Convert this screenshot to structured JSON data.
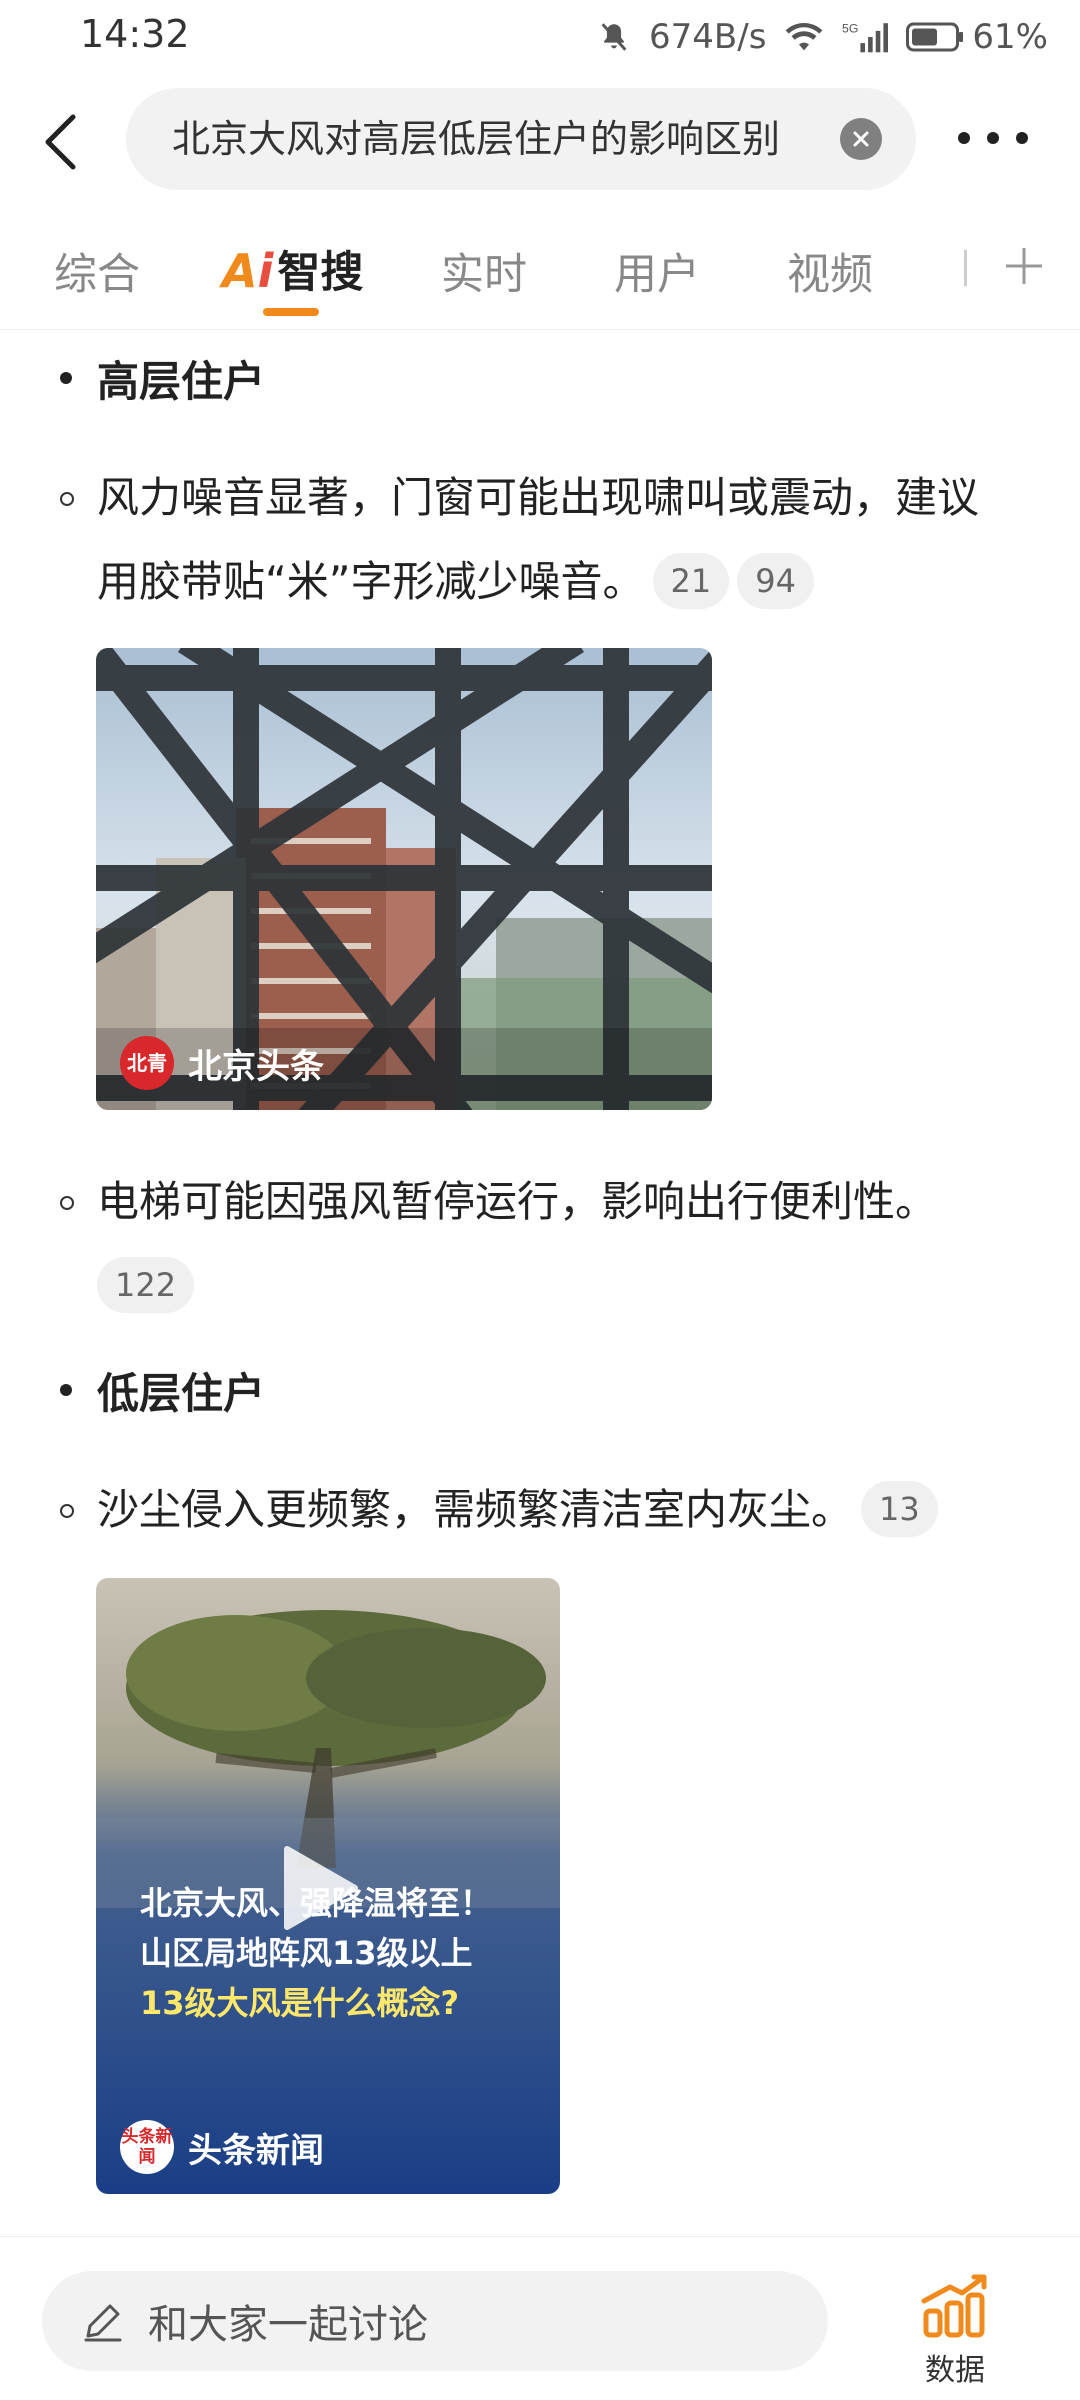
{
  "status_bar": {
    "time": "14:32",
    "network_speed": "674B/s",
    "signal_type": "5G",
    "battery_percent": "61%",
    "battery_level": 0.61
  },
  "header": {
    "search_query": "北京大风对高层低层住户的影响区别",
    "icons": [
      "back-arrow-icon",
      "clear-icon",
      "more-icon"
    ]
  },
  "tabs": {
    "items": [
      "综合",
      "智搜",
      "实时",
      "用户",
      "视频"
    ],
    "ai_prefix": "Ai",
    "active": "智搜"
  },
  "content": {
    "section1": {
      "heading": "高层住户",
      "item1": {
        "text": "风力噪音显著，门窗可能出现啸叫或震动，建议用胶带贴“米”字形减少噪音。",
        "cites": [
          "21",
          "94"
        ]
      },
      "image1": {
        "source": "北京头条",
        "logo_text": "北青"
      },
      "item2": {
        "text": "电梯可能因强风暂停运行，影响出行便利性。",
        "cites": [
          "122"
        ]
      }
    },
    "section2": {
      "heading": "低层住户",
      "item1": {
        "text": "沙尘侵入更频繁，需频繁清洁室内灰尘。",
        "cites": [
          "13"
        ]
      },
      "video1": {
        "caption_line1": "北京大风、强降温将至！",
        "caption_line2": "山区局地阵风13级以上",
        "caption_line3": "13级大风是什么概念?",
        "source": "头条新闻",
        "logo_text": "头条新闻"
      }
    }
  },
  "bottom_bar": {
    "input_placeholder": "和大家一起讨论",
    "data_label": "数据"
  },
  "colors": {
    "accent": "#f08a1c",
    "ai_red": "#e84d3d",
    "text": "#222222",
    "muted": "#888888"
  }
}
